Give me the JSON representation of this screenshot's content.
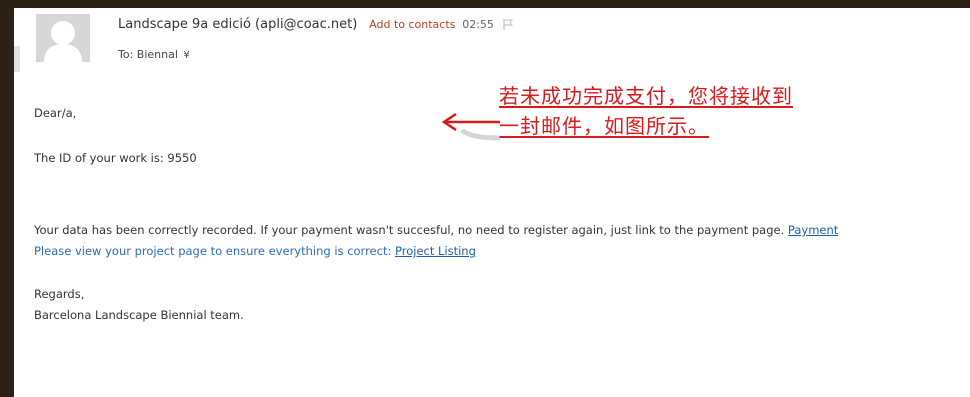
{
  "header": {
    "sender": "Landscape 9a edició (apli@coac.net)",
    "add_contact": "Add to contacts",
    "time": "02:55",
    "to_label": "To:",
    "to_value": "Biennal",
    "to_expand_glyph": "¥"
  },
  "body": {
    "greeting": "Dear/a,",
    "id_line": "The ID of your work is: 9550",
    "data_line": "Your data has been correctly recorded. If your payment wasn't succesful, no need to register again, just link to the payment page.",
    "payment_link": "Payment",
    "view_line": "Please view your project page to ensure everything is correct:",
    "project_link": "Project Listing",
    "regards": "Regards,",
    "team": "Barcelona Landscape Biennial team."
  },
  "annotation": {
    "line1": "若未成功完成支付，您将接收到",
    "line2": "一封邮件，如图所示。",
    "color": "#d9191c"
  },
  "icons": {
    "avatar": "avatar-placeholder-icon",
    "flag": "flag-icon",
    "arrow": "arrow-left-icon"
  }
}
